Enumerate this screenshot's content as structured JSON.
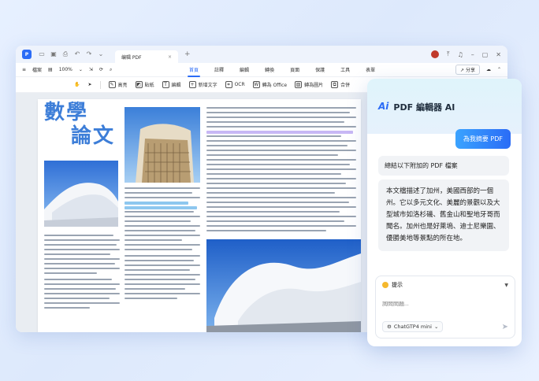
{
  "window": {
    "doc_tab_title": "编辑 PDF",
    "new_tab": "+"
  },
  "menubar": {
    "file_menu": "檔案",
    "zoom": "100%",
    "tabs": [
      {
        "label": "首頁",
        "active": true
      },
      {
        "label": "註釋",
        "active": false
      },
      {
        "label": "編輯",
        "active": false
      },
      {
        "label": "轉換",
        "active": false
      },
      {
        "label": "頁面",
        "active": false
      },
      {
        "label": "保護",
        "active": false
      },
      {
        "label": "工具",
        "active": false
      },
      {
        "label": "表單",
        "active": false
      }
    ],
    "share_label": "分享"
  },
  "toolbar": {
    "items": [
      {
        "label": "高亮",
        "icon": "highlight-icon"
      },
      {
        "label": "貼紙",
        "icon": "sticker-icon"
      },
      {
        "label": "編輯",
        "icon": "edit-icon"
      },
      {
        "label": "新增文字",
        "icon": "add-text-icon"
      },
      {
        "label": "OCR",
        "icon": "ocr-icon"
      },
      {
        "label": "轉為 Office",
        "icon": "to-office-icon"
      },
      {
        "label": "轉為圖片",
        "icon": "to-image-icon"
      },
      {
        "label": "合併",
        "icon": "merge-icon"
      }
    ]
  },
  "document": {
    "title_line1": "數學",
    "title_line2": "論文"
  },
  "ai_panel": {
    "logo": "Ai",
    "title": "PDF 編輯器 AI",
    "user_message": "為我摘要 PDF",
    "instruction": "總結以下附加的 PDF 檔案",
    "answer": "本文檔描述了加州，美國西部的一個州。它以多元文化、美麗的景觀以及大型城市如洛杉磯、舊金山和聖地牙哥而聞名。加州也是好萊塢、迪士尼樂園、優勝美地等景點的所在地。",
    "prompt_label": "提示",
    "input_placeholder": "詢問問題...",
    "model": "ChatGTP4 mini"
  },
  "colors": {
    "accent": "#2b6cf6",
    "title_blue": "#3d7ed8"
  }
}
